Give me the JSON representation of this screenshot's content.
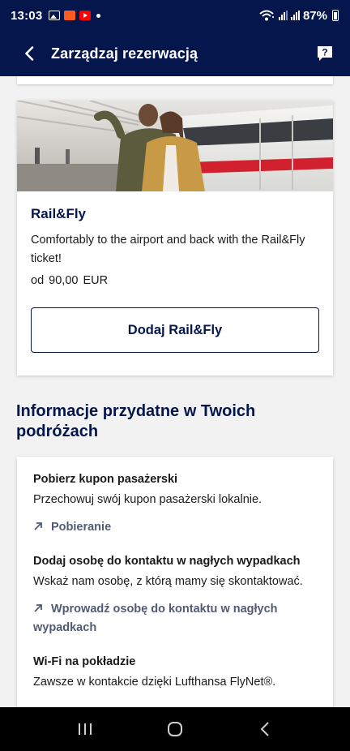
{
  "status_bar": {
    "time": "13:03",
    "battery": "87%",
    "notification_icons": [
      "gallery-icon",
      "aliexpress-icon",
      "youtube-icon"
    ],
    "system_icons": [
      "wifi-calling-icon",
      "signal-icon",
      "signal-icon",
      "battery-icon"
    ]
  },
  "header": {
    "title": "Zarządzaj rezerwacją",
    "back_icon": "back-arrow-icon",
    "help_icon": "help-chat-icon"
  },
  "rail_card": {
    "title": "Rail&Fly",
    "description": "Comfortably to the airport and back with the Rail&Fly ticket!",
    "price": "od 90,00 EUR",
    "button_label": "Dodaj Rail&Fly"
  },
  "info_section": {
    "title": "Informacje przydatne w Twoich podróżach",
    "items": [
      {
        "title": "Pobierz kupon pasażerski",
        "description": "Przechowuj swój kupon pasażerski lokalnie.",
        "link": "Pobieranie"
      },
      {
        "title": "Dodaj osobę do kontaktu w nagłych wypadkach",
        "description": "Wskaż nam osobę, z którą mamy się skontaktować.",
        "link": "Wprowadź osobę do kontaktu w nagłych wypadkach"
      },
      {
        "title": "Wi-Fi na pokładzie",
        "description": "Zawsze w kontakcie dzięki Lufthansa FlyNet®."
      }
    ]
  },
  "colors": {
    "brand_navy": "#05164d",
    "link_gray": "#515b74",
    "background": "#f2f2f2"
  },
  "nav_bar": {
    "icons": [
      "recent-apps-icon",
      "home-icon",
      "back-icon"
    ]
  }
}
